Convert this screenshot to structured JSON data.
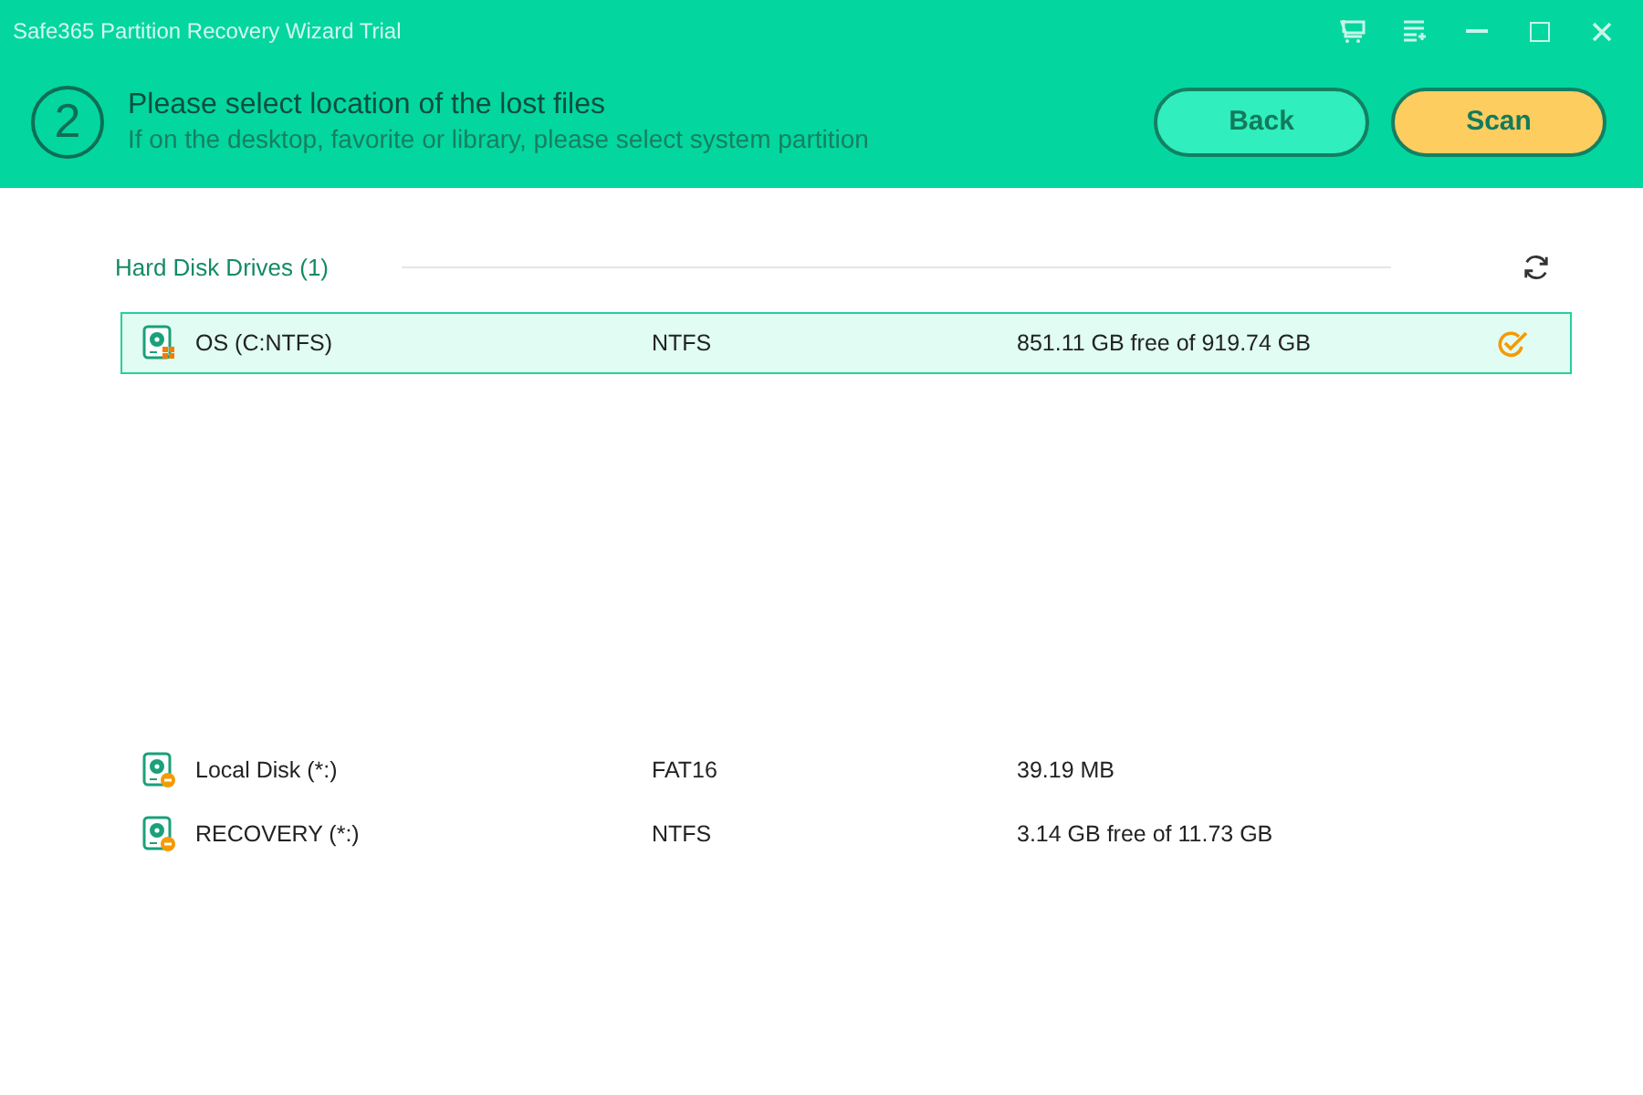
{
  "window": {
    "title": "Safe365 Partition Recovery Wizard Trial"
  },
  "step": {
    "number": "2",
    "title": "Please select location of the lost files",
    "subtitle": "If on the desktop, favorite or library, please select system partition"
  },
  "buttons": [
    {
      "label": "Back",
      "kind": "secondary"
    },
    {
      "label": "Scan",
      "kind": "primary"
    }
  ],
  "section": {
    "title": "Hard Disk Drives (1)"
  },
  "partitions": [
    {
      "name": "OS (C:NTFS)",
      "filesystem": "NTFS",
      "size": "851.11 GB free of 919.74 GB",
      "kind": "system",
      "selected": true
    }
  ],
  "other_partitions": [
    {
      "name": "Local Disk (*:)",
      "filesystem": "FAT16",
      "size": "39.19 MB",
      "kind": "lost",
      "selected": false
    },
    {
      "name": "RECOVERY (*:)",
      "filesystem": "NTFS",
      "size": "3.14 GB free of 11.73 GB",
      "kind": "lost",
      "selected": false
    }
  ]
}
